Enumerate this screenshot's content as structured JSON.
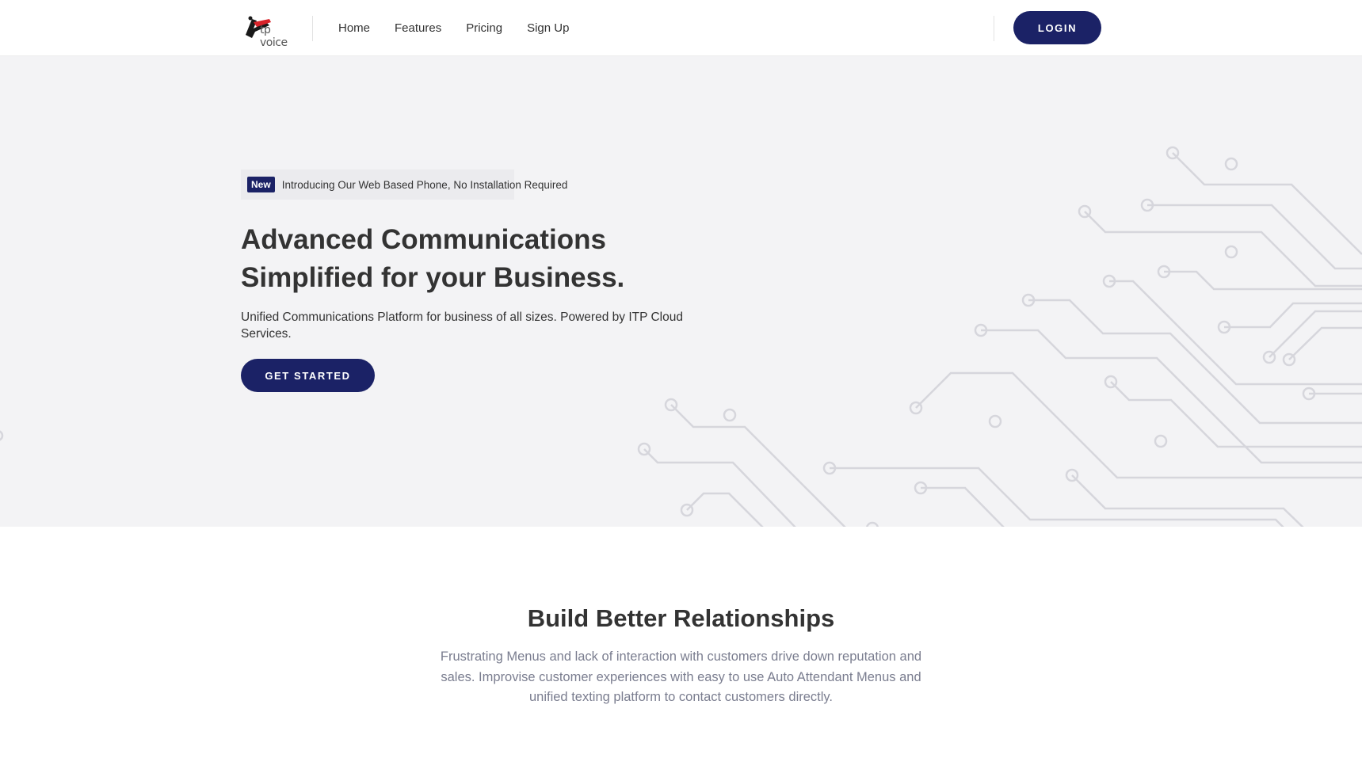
{
  "navbar": {
    "logo_text": "tp voice",
    "links": [
      {
        "label": "Home"
      },
      {
        "label": "Features"
      },
      {
        "label": "Pricing"
      },
      {
        "label": "Sign Up"
      }
    ],
    "login_label": "LOGIN"
  },
  "hero": {
    "badge": "New",
    "announcement": "Introducing Our Web Based Phone, No Installation Required",
    "title_line1": "Advanced Communications",
    "title_line2": "Simplified for your Business.",
    "subtitle": "Unified Communications Platform for business of all sizes. Powered by ITP Cloud Services.",
    "cta_label": "GET STARTED"
  },
  "features": {
    "title": "Build Better Relationships",
    "description": "Frustrating Menus and lack of interaction with customers drive down reputation and sales. Improvise customer experiences with easy to use Auto Attendant Menus and unified texting platform to contact customers directly."
  },
  "colors": {
    "primary": "#1b2266",
    "hero_bg": "#f3f3f5",
    "circuit": "#d6d6dc",
    "logo_red": "#d8232a"
  },
  "icons": {
    "logo": "itp-voice-logo-icon",
    "circuit": "circuit-pattern-decoration"
  }
}
